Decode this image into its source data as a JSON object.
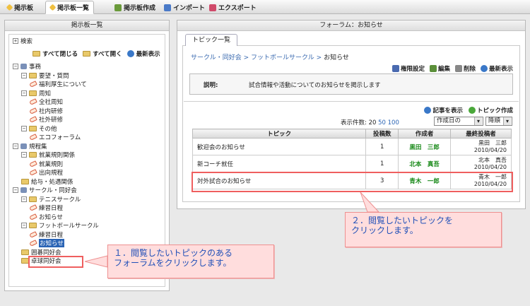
{
  "topnav": {
    "tab1": "掲示板",
    "tab2": "掲示板一覧",
    "create": "掲示板作成",
    "import": "インポート",
    "export": "エクスポート"
  },
  "left": {
    "title": "掲示板一覧",
    "search": "検索",
    "close_all": "すべて閉じる",
    "open_all": "すべて開く",
    "refresh": "最新表示",
    "tree": [
      {
        "label": "事務",
        "level": 0,
        "kind": "root"
      },
      {
        "label": "要望・質問",
        "level": 1,
        "kind": "folder"
      },
      {
        "label": "福利厚生について",
        "level": 2,
        "kind": "forum"
      },
      {
        "label": "周知",
        "level": 1,
        "kind": "folder"
      },
      {
        "label": "全社周知",
        "level": 2,
        "kind": "forum"
      },
      {
        "label": "社内研修",
        "level": 2,
        "kind": "forum"
      },
      {
        "label": "社外研修",
        "level": 2,
        "kind": "forum"
      },
      {
        "label": "その他",
        "level": 1,
        "kind": "folder"
      },
      {
        "label": "エコフォーラム",
        "level": 2,
        "kind": "forum"
      },
      {
        "label": "規程集",
        "level": 0,
        "kind": "root"
      },
      {
        "label": "就業規則関係",
        "level": 1,
        "kind": "folder"
      },
      {
        "label": "就業規則",
        "level": 2,
        "kind": "forum"
      },
      {
        "label": "出向規程",
        "level": 2,
        "kind": "forum"
      },
      {
        "label": "給与・処遇関係",
        "level": 1,
        "kind": "leaf"
      },
      {
        "label": "サークル・同好会",
        "level": 0,
        "kind": "root"
      },
      {
        "label": "テニスサークル",
        "level": 1,
        "kind": "folder"
      },
      {
        "label": "練習日程",
        "level": 2,
        "kind": "forum"
      },
      {
        "label": "お知らせ",
        "level": 2,
        "kind": "forum"
      },
      {
        "label": "フットボールサークル",
        "level": 1,
        "kind": "folder"
      },
      {
        "label": "練習日程",
        "level": 2,
        "kind": "forum"
      },
      {
        "label": "お知らせ",
        "level": 2,
        "kind": "forum",
        "selected": true
      },
      {
        "label": "囲碁同好会",
        "level": 1,
        "kind": "leaf"
      },
      {
        "label": "卓球同好会",
        "level": 1,
        "kind": "leaf"
      }
    ]
  },
  "right": {
    "title": "フォーラム：お知らせ",
    "tab": "トピック一覧",
    "breadcrumb": {
      "part1": "サークル・同好会",
      "sep": ">",
      "part2": "フットボールサークル",
      "current": "お知らせ"
    },
    "toolbar": {
      "perm": "権限設定",
      "edit": "編集",
      "delete": "削除",
      "refresh": "最新表示"
    },
    "desc_label": "説明:",
    "desc_text": "試合情報や活動についてのお知らせを掲示します",
    "toolbar2": {
      "view_posts": "記事を表示",
      "create_topic": "トピック作成"
    },
    "count_label": "表示件数:",
    "count_20": "20",
    "count_50": "50",
    "count_100": "100",
    "sort_field": "作成日の",
    "sort_order": "降順",
    "table": {
      "headers": [
        "トピック",
        "投稿数",
        "作成者",
        "最終投稿者"
      ],
      "rows": [
        {
          "topic": "歓迎会のお知らせ",
          "posts": "1",
          "author": "黒田　三郎",
          "last_name": "黒田　三郎",
          "last_date": "2010/04/20"
        },
        {
          "topic": "新コーチ就任",
          "posts": "1",
          "author": "北本　真吾",
          "last_name": "北本　真吾",
          "last_date": "2010/04/20"
        },
        {
          "topic": "対外試合のお知らせ",
          "posts": "3",
          "author": "青木　一郎",
          "last_name": "青木　一郎",
          "last_date": "2010/04/20"
        }
      ]
    }
  },
  "callouts": {
    "one": "１．閲覧したいトピックのある\nフォーラムをクリックします。",
    "two": "２．閲覧したいトピックを\nクリックします。"
  }
}
